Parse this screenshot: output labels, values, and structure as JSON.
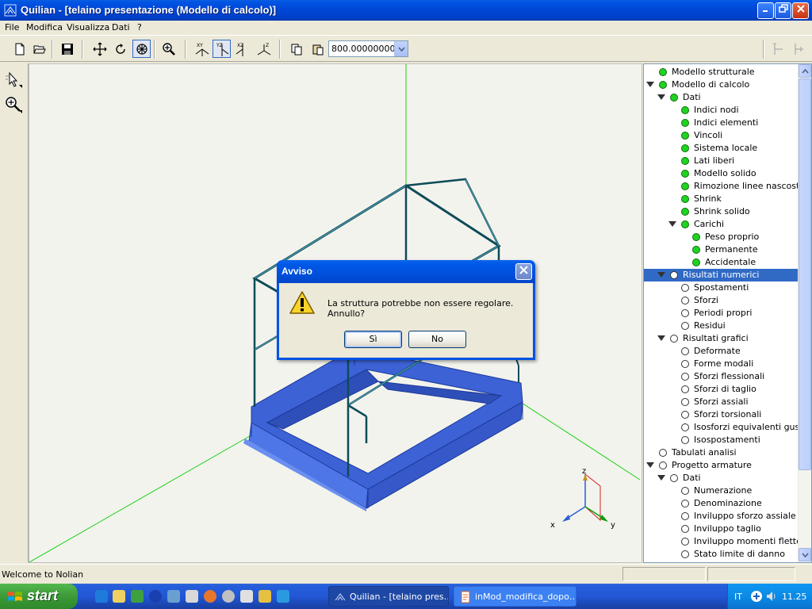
{
  "window": {
    "title": "Quilian - [telaino presentazione (Modello di calcolo)]"
  },
  "menubar": [
    "File",
    "Modifica",
    "Visualizza",
    "Dati",
    "?"
  ],
  "toolbar": {
    "zoom_value": "800.000000000",
    "buttons": [
      "new-icon",
      "open-icon",
      "save-icon",
      "pan-icon",
      "rotate-icon",
      "orbit-icon",
      "zoom-icon",
      "view-xy-icon",
      "view-yz-icon",
      "view-xz-icon",
      "view-3d-icon",
      "copy-icon",
      "paste-icon",
      "align-left-icon",
      "align-right-icon"
    ]
  },
  "axes_labels": {
    "x": "x",
    "y": "y",
    "z": "z"
  },
  "tree": [
    {
      "label": "Modello strutturale",
      "level": 1,
      "state": "on",
      "expandable": false
    },
    {
      "label": "Modello di calcolo",
      "level": 1,
      "state": "on",
      "expandable": true
    },
    {
      "label": "Dati",
      "level": 2,
      "state": "on",
      "expandable": true
    },
    {
      "label": "Indici nodi",
      "level": 3,
      "state": "on",
      "expandable": false
    },
    {
      "label": "Indici elementi",
      "level": 3,
      "state": "on",
      "expandable": false
    },
    {
      "label": "Vincoli",
      "level": 3,
      "state": "on",
      "expandable": false
    },
    {
      "label": "Sistema locale",
      "level": 3,
      "state": "on",
      "expandable": false
    },
    {
      "label": "Lati liberi",
      "level": 3,
      "state": "on",
      "expandable": false
    },
    {
      "label": "Modello solido",
      "level": 3,
      "state": "on",
      "expandable": false
    },
    {
      "label": "Rimozione linee nascoste",
      "level": 3,
      "state": "on",
      "expandable": false
    },
    {
      "label": "Shrink",
      "level": 3,
      "state": "on",
      "expandable": false
    },
    {
      "label": "Shrink solido",
      "level": 3,
      "state": "on",
      "expandable": false
    },
    {
      "label": "Carichi",
      "level": 3,
      "state": "on",
      "expandable": true
    },
    {
      "label": "Peso proprio",
      "level": 4,
      "state": "on",
      "expandable": false
    },
    {
      "label": "Permanente",
      "level": 4,
      "state": "on",
      "expandable": false
    },
    {
      "label": "Accidentale",
      "level": 4,
      "state": "on",
      "expandable": false
    },
    {
      "label": "Risultati numerici",
      "level": 2,
      "state": "off",
      "expandable": true,
      "selected": true
    },
    {
      "label": "Spostamenti",
      "level": 3,
      "state": "off",
      "expandable": false
    },
    {
      "label": "Sforzi",
      "level": 3,
      "state": "off",
      "expandable": false
    },
    {
      "label": "Periodi propri",
      "level": 3,
      "state": "off",
      "expandable": false
    },
    {
      "label": "Residui",
      "level": 3,
      "state": "off",
      "expandable": false
    },
    {
      "label": "Risultati grafici",
      "level": 2,
      "state": "off",
      "expandable": true
    },
    {
      "label": "Deformate",
      "level": 3,
      "state": "off",
      "expandable": false
    },
    {
      "label": "Forme modali",
      "level": 3,
      "state": "off",
      "expandable": false
    },
    {
      "label": "Sforzi flessionali",
      "level": 3,
      "state": "off",
      "expandable": false
    },
    {
      "label": "Sforzi di taglio",
      "level": 3,
      "state": "off",
      "expandable": false
    },
    {
      "label": "Sforzi assiali",
      "level": 3,
      "state": "off",
      "expandable": false
    },
    {
      "label": "Sforzi torsionali",
      "level": 3,
      "state": "off",
      "expandable": false
    },
    {
      "label": "Isosforzi equivalenti gus…",
      "level": 3,
      "state": "off",
      "expandable": false
    },
    {
      "label": "Isospostamenti",
      "level": 3,
      "state": "off",
      "expandable": false
    },
    {
      "label": "Tabulati analisi",
      "level": 1,
      "state": "off",
      "expandable": false
    },
    {
      "label": "Progetto armature",
      "level": 1,
      "state": "off",
      "expandable": true
    },
    {
      "label": "Dati",
      "level": 2,
      "state": "off",
      "expandable": true
    },
    {
      "label": "Numerazione",
      "level": 3,
      "state": "off",
      "expandable": false
    },
    {
      "label": "Denominazione",
      "level": 3,
      "state": "off",
      "expandable": false
    },
    {
      "label": "Inviluppo sforzo assiale",
      "level": 3,
      "state": "off",
      "expandable": false
    },
    {
      "label": "Inviluppo taglio",
      "level": 3,
      "state": "off",
      "expandable": false
    },
    {
      "label": "Inviluppo momenti flettenti",
      "level": 3,
      "state": "off",
      "expandable": false
    },
    {
      "label": "Stato limite di danno",
      "level": 3,
      "state": "off",
      "expandable": false
    }
  ],
  "statusbar": {
    "text": "Welcome to Nolian"
  },
  "dialog": {
    "title": "Avviso",
    "message": "La struttura potrebbe non essere regolare. Annullo?",
    "yes_label": "Sì",
    "no_label": "No"
  },
  "taskbar": {
    "start_label": "start",
    "tasks": [
      {
        "label": "Quilian - [telaino pres…",
        "active": true
      },
      {
        "label": "inMod_modifica_dopo…",
        "active": false
      }
    ],
    "language": "IT",
    "clock": "11.25"
  },
  "colors": {
    "titlebar": "#0054e3",
    "selection": "#316ac5",
    "tree_on": "#21d321",
    "model_base": "#3d62d6",
    "model_frame": "#0d4b59"
  }
}
